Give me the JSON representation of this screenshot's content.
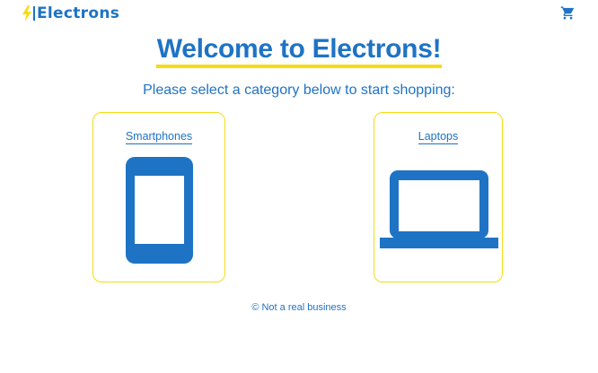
{
  "header": {
    "brand": "Electrons",
    "bolt_icon": "lightning-bolt-icon",
    "cart_icon": "shopping-cart-icon"
  },
  "main": {
    "title": "Welcome to Electrons!",
    "subtitle": "Please select a category below to start shopping:",
    "categories": [
      {
        "label": "Smartphones",
        "icon": "smartphone-icon"
      },
      {
        "label": "Laptops",
        "icon": "laptop-icon"
      }
    ]
  },
  "footer": {
    "text": "© Not a real business"
  },
  "colors": {
    "primary": "#1e73c4",
    "accent": "#f5dc14",
    "background": "#ffffff"
  }
}
